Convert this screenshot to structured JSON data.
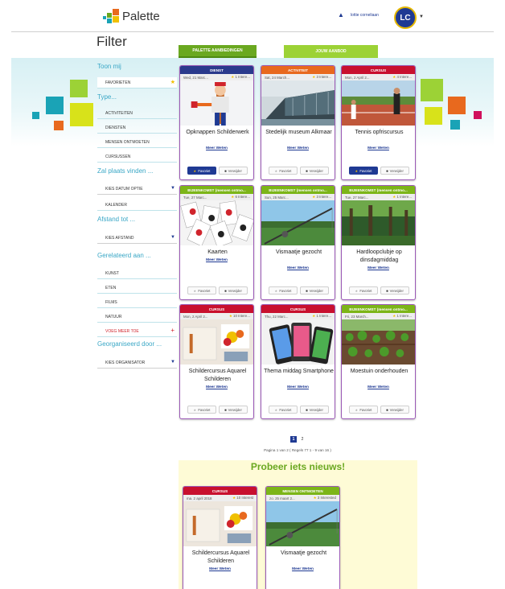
{
  "header": {
    "logo_text": "Palette",
    "user_name": "lottie corneliaan",
    "avatar_initials": "LC"
  },
  "page": {
    "title": "Filter"
  },
  "tabs": [
    {
      "label": "PALETTE AANBIEDINGEN",
      "active": true
    },
    {
      "label": "JOUW AANBOD",
      "active": false
    }
  ],
  "sidebar": {
    "show_me": "Toon mij",
    "favorites": "FAVORIETEN",
    "type_heading": "Type...",
    "types": [
      "ACTIVITEITEN",
      "DIENSTEN",
      "MENSEN ONTMOETEN",
      "CURSUSSEN"
    ],
    "date_heading": "Zal plaats vinden ...",
    "date_select": "KIES DATUM OPTIE",
    "calendar": "KALENDER",
    "distance_heading": "Afstand tot ...",
    "distance_select": "KIES AFSTAND",
    "related_heading": "Gerelateerd aan ...",
    "related": [
      "KUNST",
      "ETEN",
      "FILMS",
      "NATUUR"
    ],
    "add_related": "VOEG MEER TOE",
    "organised_heading": "Georganiseerd door ...",
    "organiser_select": "KIES ORGANISATOR"
  },
  "cards": [
    {
      "category": "DIENST",
      "color": "#2a3a8c",
      "date": "Wed, 21 Marc...",
      "interest": "1 Intere...",
      "title": "Opknappen Schilderwerk",
      "link": "Meer Weten",
      "fav": "Favoriet",
      "fav_active": true,
      "share": "Verwijder",
      "img": "painter"
    },
    {
      "category": "ACTIVITEIT",
      "color": "#e8691e",
      "date": "Sat, 24 March...",
      "interest": "3 Intere...",
      "title": "Stedelijk museum Alkmaar",
      "link": "Meer Weten",
      "fav": "Favoriet",
      "fav_active": false,
      "share": "Verwijder",
      "img": "museum"
    },
    {
      "category": "CURSUS",
      "color": "#c8102e",
      "date": "Mon, 2 April 2...",
      "interest": "4 Intere...",
      "title": "Tennis opfriscursus",
      "link": "Meer Weten",
      "fav": "Favoriet",
      "fav_active": true,
      "share": "Verwijder",
      "img": "tennis"
    },
    {
      "category": "BIJEENKOMST (mensen ontmo...",
      "color": "#7cb518",
      "date": "Tue, 27 Marc...",
      "interest": "6 Intere...",
      "title": "Kaarten",
      "link": "Meer Weten",
      "fav": "Favoriet",
      "fav_active": false,
      "share": "Verwijder",
      "img": "cards"
    },
    {
      "category": "BIJEENKOMST (mensen ontmo...",
      "color": "#7cb518",
      "date": "Sun, 25 Marc...",
      "interest": "3 Intere...",
      "title": "Vismaatje gezocht",
      "link": "Meer Weten",
      "fav": "Favoriet",
      "fav_active": false,
      "share": "Verwijder",
      "img": "fishing"
    },
    {
      "category": "BIJEENKOMST (mensen ontmo...",
      "color": "#7cb518",
      "date": "Tue, 27 Marc...",
      "interest": "1 Intere...",
      "title": "Hardloopclubje op dinsdagmiddag",
      "link": "Meer Weten",
      "fav": "Favoriet",
      "fav_active": false,
      "share": "Verwijder",
      "img": "forest"
    },
    {
      "category": "CURSUS",
      "color": "#c8102e",
      "date": "Mon, 2 April 2...",
      "interest": "10 Intere...",
      "title": "Schildercursus Aquarel Schilderen",
      "link": "Meer Weten",
      "fav": "Favoriet",
      "fav_active": false,
      "share": "Verwijder",
      "img": "paint"
    },
    {
      "category": "CURSUS",
      "color": "#c8102e",
      "date": "Thu, 22 Marc...",
      "interest": "1 Intere...",
      "title": "Thema middag Smartphone",
      "link": "Meer Weten",
      "fav": "Favoriet",
      "fav_active": false,
      "share": "Verwijder",
      "img": "phone"
    },
    {
      "category": "BIJEENKOMST (mensen ontmo...",
      "color": "#7cb518",
      "date": "Fri, 23 March...",
      "interest": "1 Intere...",
      "title": "Moestuin onderhouden",
      "link": "Meer Weten",
      "fav": "Favoriet",
      "fav_active": false,
      "share": "Verwijder",
      "img": "garden"
    }
  ],
  "pager": {
    "pages": [
      "1",
      "2"
    ],
    "current": "1",
    "info": "Pagina 1 van 2 ( Regels 77 1 - 9 van 16 )"
  },
  "try_new": {
    "title": "Probeer iets nieuws!",
    "cards": [
      {
        "category": "CURSUS",
        "color": "#c8102e",
        "date": "ma. 2 april 2018",
        "interest": "10 Interest",
        "title": "Schildercursus Aquarel Schilderen",
        "link": "Meer Weten",
        "img": "paint"
      },
      {
        "category": "MENSEN ONTMOETEN",
        "color": "#7cb518",
        "date": "zo. 25 maart 2...",
        "interest": "3 Interested",
        "title": "Vismaatje gezocht",
        "link": "Meer Weten",
        "img": "fishing"
      }
    ]
  }
}
